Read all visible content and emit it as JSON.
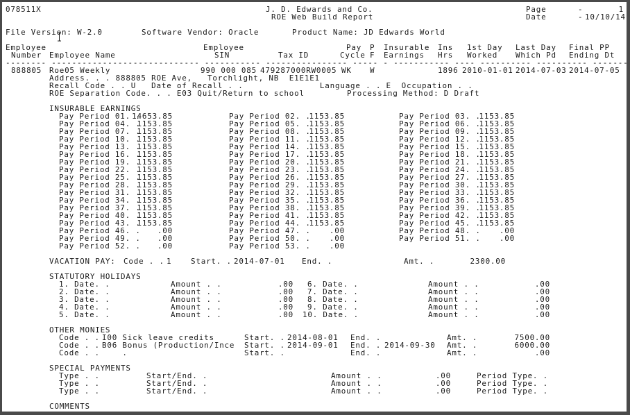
{
  "report": {
    "program_id": "078511X",
    "company": "J. D. Edwards and Co.",
    "title": "ROE Web Build Report",
    "page_label": "Page",
    "page_sep": "-",
    "page_value": "1",
    "date_label": "Date",
    "date_sep": "-",
    "date_value": "10/10/14"
  },
  "meta": {
    "file_version": "File Version: W-2.0",
    "software_vendor": "Software Vendor: Oracle",
    "product_name": "Product Name: JD Edwards World"
  },
  "columns": {
    "row1": [
      "Employee",
      "Employee",
      "Pay",
      "P",
      "Insurable",
      "Ins",
      "1st Day",
      "Last Day",
      "Final PP"
    ],
    "row2": [
      "Number",
      "Employee Name",
      "SIN",
      "Tax ID",
      "Cycle",
      "F",
      "Earnings",
      "Hrs",
      "Worked",
      "Which Pd",
      "Ending Dt"
    ]
  },
  "employee": {
    "number": "888805",
    "name": "Roe05 Weekly",
    "sin": "990 000 085",
    "tax_id": "479287000RW0005",
    "pay_cycle": "WK",
    "pf": "W",
    "insurable_earnings": "",
    "ins_hrs": "1896",
    "first_day_worked": "2010-01-01",
    "last_day_paid": "2014-07-03",
    "final_pp_ending": "2014-07-05",
    "address_line": "Address. . . 888805 ROE Ave,   Torchlight, NB  E1E1E1",
    "recall_line": "Recall Code . . U   Date of Recall . .               Language . . E  Occupation . .",
    "separation_line": "ROE Separation Code. . . E03 Quit/Return to school",
    "processing_method": "Processing Method: D Draft"
  },
  "insurable_earnings": {
    "heading": "INSURABLE EARNINGS",
    "periods": [
      {
        "label": "Pay Period 01. .",
        "amount": "14653.85"
      },
      {
        "label": "Pay Period 02. .",
        "amount": "1153.85"
      },
      {
        "label": "Pay Period 03. .",
        "amount": "1153.85"
      },
      {
        "label": "Pay Period 04. .",
        "amount": "1153.85"
      },
      {
        "label": "Pay Period 05. .",
        "amount": "1153.85"
      },
      {
        "label": "Pay Period 06. .",
        "amount": "1153.85"
      },
      {
        "label": "Pay Period 07. .",
        "amount": "1153.85"
      },
      {
        "label": "Pay Period 08. .",
        "amount": "1153.85"
      },
      {
        "label": "Pay Period 09. .",
        "amount": "1153.85"
      },
      {
        "label": "Pay Period 10. .",
        "amount": "1153.85"
      },
      {
        "label": "Pay Period 11. .",
        "amount": "1153.85"
      },
      {
        "label": "Pay Period 12. .",
        "amount": "1153.85"
      },
      {
        "label": "Pay Period 13. .",
        "amount": "1153.85"
      },
      {
        "label": "Pay Period 14. .",
        "amount": "1153.85"
      },
      {
        "label": "Pay Period 15. .",
        "amount": "1153.85"
      },
      {
        "label": "Pay Period 16. .",
        "amount": "1153.85"
      },
      {
        "label": "Pay Period 17. .",
        "amount": "1153.85"
      },
      {
        "label": "Pay Period 18. .",
        "amount": "1153.85"
      },
      {
        "label": "Pay Period 19. .",
        "amount": "1153.85"
      },
      {
        "label": "Pay Period 20. .",
        "amount": "1153.85"
      },
      {
        "label": "Pay Period 21. .",
        "amount": "1153.85"
      },
      {
        "label": "Pay Period 22. .",
        "amount": "1153.85"
      },
      {
        "label": "Pay Period 23. .",
        "amount": "1153.85"
      },
      {
        "label": "Pay Period 24. .",
        "amount": "1153.85"
      },
      {
        "label": "Pay Period 25. .",
        "amount": "1153.85"
      },
      {
        "label": "Pay Period 26. .",
        "amount": "1153.85"
      },
      {
        "label": "Pay Period 27. .",
        "amount": "1153.85"
      },
      {
        "label": "Pay Period 28. .",
        "amount": "1153.85"
      },
      {
        "label": "Pay Period 29. .",
        "amount": "1153.85"
      },
      {
        "label": "Pay Period 30. .",
        "amount": "1153.85"
      },
      {
        "label": "Pay Period 31. .",
        "amount": "1153.85"
      },
      {
        "label": "Pay Period 32. .",
        "amount": "1153.85"
      },
      {
        "label": "Pay Period 33. .",
        "amount": "1153.85"
      },
      {
        "label": "Pay Period 34. .",
        "amount": "1153.85"
      },
      {
        "label": "Pay Period 35. .",
        "amount": "1153.85"
      },
      {
        "label": "Pay Period 36. .",
        "amount": "1153.85"
      },
      {
        "label": "Pay Period 37. .",
        "amount": "1153.85"
      },
      {
        "label": "Pay Period 38. .",
        "amount": "1153.85"
      },
      {
        "label": "Pay Period 39. .",
        "amount": "1153.85"
      },
      {
        "label": "Pay Period 40. .",
        "amount": "1153.85"
      },
      {
        "label": "Pay Period 41. .",
        "amount": "1153.85"
      },
      {
        "label": "Pay Period 42. .",
        "amount": "1153.85"
      },
      {
        "label": "Pay Period 43. .",
        "amount": "1153.85"
      },
      {
        "label": "Pay Period 44. .",
        "amount": "1153.85"
      },
      {
        "label": "Pay Period 45. .",
        "amount": "1153.85"
      },
      {
        "label": "Pay Period 46. .",
        "amount": ".00"
      },
      {
        "label": "Pay Period 47. .",
        "amount": ".00"
      },
      {
        "label": "Pay Period 48. .",
        "amount": ".00"
      },
      {
        "label": "Pay Period 49. .",
        "amount": ".00"
      },
      {
        "label": "Pay Period 50. .",
        "amount": ".00"
      },
      {
        "label": "Pay Period 51. .",
        "amount": ".00"
      },
      {
        "label": "Pay Period 52. .",
        "amount": ".00"
      },
      {
        "label": "Pay Period 53. .",
        "amount": ".00"
      }
    ]
  },
  "vacation_pay": {
    "label": "VACATION PAY:",
    "code_label": "Code . .",
    "code": "1",
    "start_label": "Start. .",
    "start": "2014-07-01",
    "end_label": "End. .",
    "end": "",
    "amt_label": "Amt. .",
    "amt": "2300.00"
  },
  "statutory_holidays": {
    "heading": "STATUTORY HOLIDAYS",
    "items": [
      {
        "label": "1. Date. .",
        "amount_label": "Amount . .",
        "amount": ".00"
      },
      {
        "label": "2. Date. .",
        "amount_label": "Amount . .",
        "amount": ".00"
      },
      {
        "label": "3. Date. .",
        "amount_label": "Amount . .",
        "amount": ".00"
      },
      {
        "label": "4. Date. .",
        "amount_label": "Amount . .",
        "amount": ".00"
      },
      {
        "label": "5. Date. .",
        "amount_label": "Amount . .",
        "amount": ".00"
      },
      {
        "label": "6. Date. .",
        "amount_label": "Amount . .",
        "amount": ".00"
      },
      {
        "label": "7. Date. .",
        "amount_label": "Amount . .",
        "amount": ".00"
      },
      {
        "label": "8. Date. .",
        "amount_label": "Amount . .",
        "amount": ".00"
      },
      {
        "label": "9. Date. .",
        "amount_label": "Amount . .",
        "amount": ".00"
      },
      {
        "label": "10. Date. .",
        "amount_label": "Amount . .",
        "amount": ".00"
      }
    ]
  },
  "other_monies": {
    "heading": "OTHER MONIES",
    "items": [
      {
        "code_label": "Code . .",
        "code": "I00 Sick leave credits",
        "start_label": "Start. .",
        "start": "2014-08-01",
        "end_label": "End. .",
        "end": "",
        "amt_label": "Amt. .",
        "amt": "7500.00"
      },
      {
        "code_label": "Code . .",
        "code": "B06 Bonus (Production/Ince",
        "start_label": "Start. .",
        "start": "2014-09-01",
        "end_label": "End. .",
        "end": "2014-09-30",
        "amt_label": "Amt. .",
        "amt": "6000.00"
      },
      {
        "code_label": "Code . .",
        "code": "    .",
        "start_label": "Start. .",
        "start": "",
        "end_label": "End. .",
        "end": "",
        "amt_label": "Amt. .",
        "amt": ".00"
      }
    ]
  },
  "special_payments": {
    "heading": "SPECIAL PAYMENTS",
    "items": [
      {
        "type_label": "Type . .",
        "start_end_label": "Start/End. .",
        "amount_label": "Amount . .",
        "amount": ".00",
        "period_type_label": "Period Type. ."
      },
      {
        "type_label": "Type . .",
        "start_end_label": "Start/End. .",
        "amount_label": "Amount . .",
        "amount": ".00",
        "period_type_label": "Period Type. ."
      },
      {
        "type_label": "Type . .",
        "start_end_label": "Start/End. .",
        "amount_label": "Amount . .",
        "amount": ".00",
        "period_type_label": "Period Type. ."
      }
    ]
  },
  "comments": {
    "heading": "COMMENTS"
  }
}
